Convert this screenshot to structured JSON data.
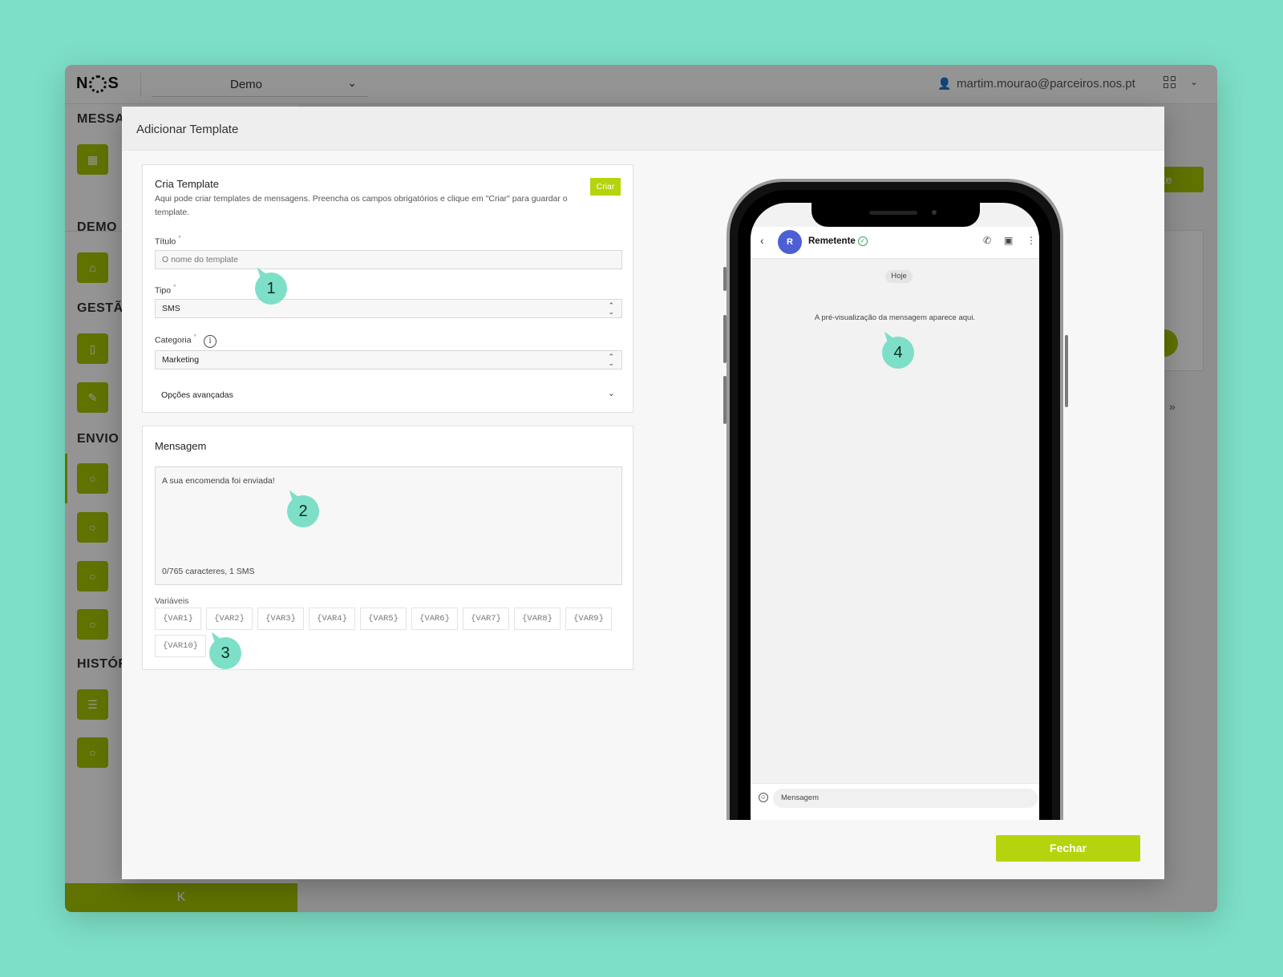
{
  "app": {
    "logo": "NOS",
    "org_select": "Demo",
    "user_email": "martim.mourao@parceiros.nos.pt",
    "sidebar": {
      "sections": [
        "MESSAG",
        "DEMO",
        "GESTÃO",
        "ENVIO",
        "HISTÓR"
      ],
      "collapse_label": "K"
    },
    "bg_button_label": "plate",
    "bg_arrows": "»",
    "colors": {
      "brand": "#a6c500",
      "accent": "#b5d40d",
      "highlight": "#7ddfc7"
    }
  },
  "modal": {
    "title": "Adicionar Template",
    "create_card": {
      "title": "Cria Template",
      "description": "Aqui pode criar templates de mensagens. Preencha os campos obrigatórios e clique em \"Criar\" para guardar o template.",
      "create_button": "Criar",
      "fields": {
        "title_label": "Título",
        "title_placeholder": "O nome do template",
        "type_label": "Tipo",
        "type_value": "SMS",
        "category_label": "Categoria",
        "category_value": "Marketing",
        "required_mark": "*"
      },
      "advanced_options": "Opções avançadas"
    },
    "message_card": {
      "title": "Mensagem",
      "message_text": "A sua encomenda foi enviada!",
      "char_count": "0/765 caracteres, 1 SMS",
      "variables_label": "Variáveis",
      "variables": [
        "{VAR1}",
        "{VAR2}",
        "{VAR3}",
        "{VAR4}",
        "{VAR5}",
        "{VAR6}",
        "{VAR7}",
        "{VAR8}",
        "{VAR9}",
        "{VAR10}"
      ]
    },
    "phone_preview": {
      "avatar_letter": "R",
      "sender": "Remetente",
      "date_chip": "Hoje",
      "preview_text": "A pré-visualização da mensagem aparece aqui.",
      "composer_placeholder": "Mensagem"
    },
    "close_button": "Fechar",
    "annotations": [
      "1",
      "2",
      "3",
      "4"
    ]
  }
}
